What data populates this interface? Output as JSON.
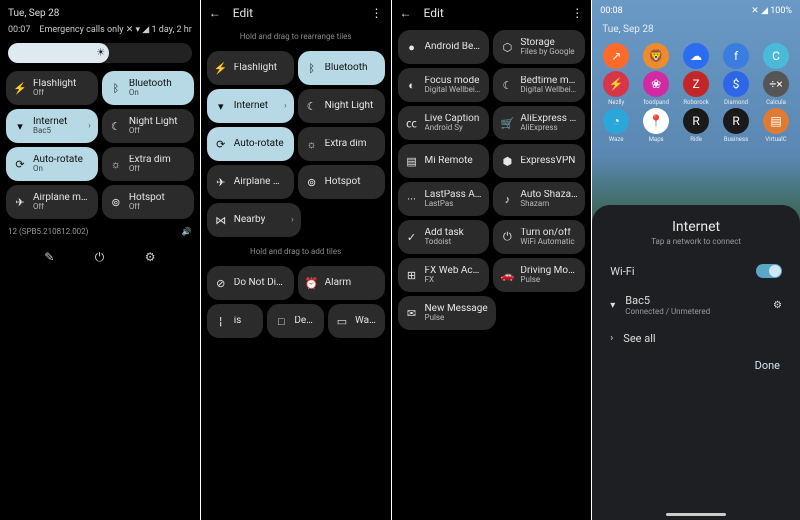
{
  "pane1": {
    "date": "Tue, Sep 28",
    "time": "00:07",
    "status_right": "Emergency calls only  ✕  ▾ ◢ 1 day, 2 hr",
    "tiles": [
      [
        {
          "icon": "⚡",
          "label": "Flashlight",
          "sub": "Off",
          "on": false
        },
        {
          "icon": "ᛒ",
          "label": "Bluetooth",
          "sub": "On",
          "on": true
        }
      ],
      [
        {
          "icon": "▾",
          "label": "Internet",
          "sub": "Bac5",
          "on": true,
          "chev": true
        },
        {
          "icon": "☾",
          "label": "Night Light",
          "sub": "Off",
          "on": false
        }
      ],
      [
        {
          "icon": "⟳",
          "label": "Auto-rotate",
          "sub": "On",
          "on": true
        },
        {
          "icon": "☼",
          "label": "Extra dim",
          "sub": "Off",
          "on": false
        }
      ],
      [
        {
          "icon": "✈",
          "label": "Airplane mode",
          "sub": "Off",
          "on": false
        },
        {
          "icon": "⊚",
          "label": "Hotspot",
          "sub": "Off",
          "on": false
        }
      ]
    ],
    "build": "12 (SPB5.210812.002)",
    "bottom": {
      "edit": "✎",
      "power": "⏻",
      "settings": "⚙"
    }
  },
  "pane2": {
    "title": "Edit",
    "hint_top": "Hold and drag to rearrange tiles",
    "tiles_top": [
      [
        {
          "icon": "⚡",
          "label": "Flashlight",
          "on": false
        },
        {
          "icon": "ᛒ",
          "label": "Bluetooth",
          "on": true
        }
      ],
      [
        {
          "icon": "▾",
          "label": "Internet",
          "on": true,
          "chev": true
        },
        {
          "icon": "☾",
          "label": "Night Light",
          "on": false
        }
      ],
      [
        {
          "icon": "⟳",
          "label": "Auto-rotate",
          "on": true
        },
        {
          "icon": "☼",
          "label": "Extra dim",
          "on": false
        }
      ],
      [
        {
          "icon": "✈",
          "label": "Airplane mode",
          "on": false
        },
        {
          "icon": "⊚",
          "label": "Hotspot",
          "on": false
        }
      ],
      [
        {
          "icon": "⋈",
          "label": "Nearby",
          "on": false,
          "chev": true,
          "solo": true
        }
      ]
    ],
    "hint_bottom": "Hold and drag to add tiles",
    "tiles_bottom": [
      [
        {
          "icon": "⊘",
          "label": "Do Not Disturb"
        },
        {
          "icon": "⏰",
          "label": "Alarm"
        }
      ],
      [
        {
          "icon": "¦",
          "label": "is"
        },
        {
          "icon": "□",
          "label": "Device"
        },
        {
          "icon": "▭",
          "label": "Wallet"
        }
      ]
    ]
  },
  "pane3": {
    "title": "Edit",
    "tiles": [
      [
        {
          "icon": "●",
          "label": "Android Beta Pro"
        },
        {
          "icon": "⬡",
          "label": "Storage",
          "sub": "Files by Google"
        }
      ],
      [
        {
          "icon": "◐",
          "label": "Focus mode",
          "sub": "Digital Wellbeing"
        },
        {
          "icon": "☾",
          "label": "Bedtime mode",
          "sub": "Digital Wellbeing"
        }
      ],
      [
        {
          "icon": "㏄",
          "label": "Live Caption",
          "sub": "Android Sy"
        },
        {
          "icon": "🛒",
          "label": "AliExpress Sc",
          "sub": "AliExpress"
        }
      ],
      [
        {
          "icon": "▤",
          "label": "Mi Remote"
        },
        {
          "icon": "⬢",
          "label": "ExpressVPN"
        }
      ],
      [
        {
          "icon": "···",
          "label": "LastPass Autofil",
          "sub": "LastPas"
        },
        {
          "icon": "♪",
          "label": "Auto Shazam",
          "sub": "Shazam"
        }
      ],
      [
        {
          "icon": "✓",
          "label": "Add task",
          "sub": "Todoist"
        },
        {
          "icon": "⏻",
          "label": "Turn on/off",
          "sub": "WiFi Automatic"
        }
      ],
      [
        {
          "icon": "⊞",
          "label": "FX Web Access",
          "sub": "FX"
        },
        {
          "icon": "🚗",
          "label": "Driving Mode",
          "sub": "Pulse"
        }
      ],
      [
        {
          "icon": "✉",
          "label": "New Message",
          "sub": "Pulse",
          "solo": true
        }
      ]
    ]
  },
  "pane4": {
    "time": "00:08",
    "status_right": "✕  ◢ 100%",
    "date": "Tue, Sep 28",
    "app_rows": [
      [
        {
          "c": "#ff6a2a",
          "g": "↗"
        },
        {
          "c": "#f08a2a",
          "g": "🦁"
        },
        {
          "c": "#2b6cf0",
          "g": "☁"
        },
        {
          "c": "#3a7de0",
          "g": "f"
        },
        {
          "c": "#4bbad8",
          "g": "C"
        }
      ],
      [
        {
          "c": "#d9354a",
          "g": "⚡",
          "cap": "Nezlly"
        },
        {
          "c": "#d12aa3",
          "g": "❀",
          "cap": "foodpand"
        },
        {
          "c": "#c22626",
          "g": "Z",
          "cap": "Roborock"
        },
        {
          "c": "#2e66e8",
          "g": "$",
          "cap": "Diamond"
        },
        {
          "c": "#555",
          "g": "÷×",
          "cap": "Calcula"
        }
      ],
      [
        {
          "c": "#2aa7d8",
          "g": "◔",
          "cap": "Waze"
        },
        {
          "c": "#fff",
          "g": "📍",
          "cap": "Maps",
          "fg": "#2a8"
        },
        {
          "c": "#1a1a1a",
          "g": "R",
          "cap": "Ride"
        },
        {
          "c": "#1a1a1a",
          "g": "R",
          "cap": "Business"
        },
        {
          "c": "#e07a33",
          "g": "▤",
          "cap": "VirtualC"
        }
      ]
    ],
    "panel": {
      "title": "Internet",
      "sub": "Tap a network to connect",
      "wifi_label": "Wi-Fi",
      "network_name": "Bac5",
      "network_sub": "Connected / Unmetered",
      "see_all": "See all",
      "done": "Done"
    }
  }
}
